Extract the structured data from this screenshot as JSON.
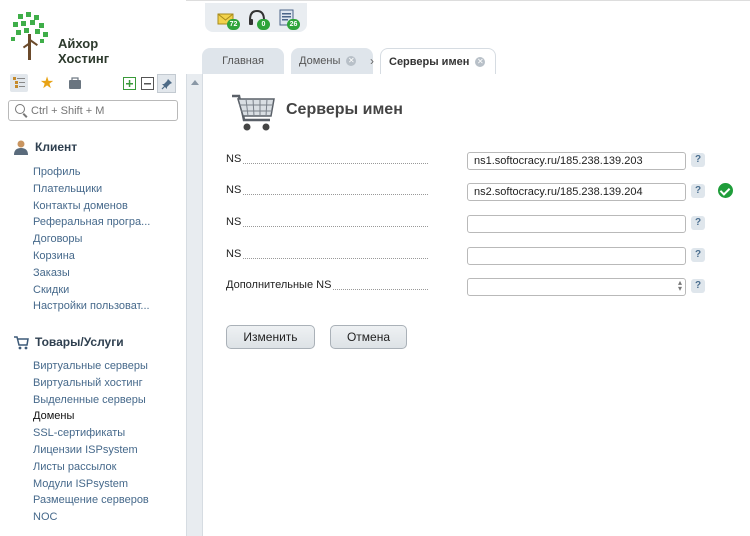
{
  "brand": {
    "line1": "Айхор",
    "line2": "Хостинг"
  },
  "search": {
    "placeholder": "Ctrl + Shift + M"
  },
  "notifications": [
    {
      "icon": "mail-icon",
      "count": "72"
    },
    {
      "icon": "headset-icon",
      "count": "0"
    },
    {
      "icon": "document-icon",
      "count": "26"
    }
  ],
  "tabs": [
    {
      "label": "Главная"
    },
    {
      "label": "Домены"
    },
    {
      "label": "Серверы имен"
    }
  ],
  "client": {
    "title": "Клиент",
    "items": [
      "Профиль",
      "Плательщики",
      "Контакты доменов",
      "Реферальная програ...",
      "Договоры",
      "Корзина",
      "Заказы",
      "Скидки",
      "Настройки пользоват..."
    ]
  },
  "goods": {
    "title": "Товары/Услуги",
    "items": [
      "Виртуальные серверы",
      "Виртуальный хостинг",
      "Выделенные серверы",
      "Домены",
      "SSL-сертификаты",
      "Лицензии ISPsystem",
      "Листы рассылок",
      "Модули ISPsystem",
      "Размещение серверов",
      "NOC"
    ],
    "active": "Домены"
  },
  "form": {
    "title": "Серверы имен",
    "rows": [
      {
        "label": "NS",
        "value": "ns1.softocracy.ru/185.238.139.203"
      },
      {
        "label": "NS",
        "value": "ns2.softocracy.ru/185.238.139.204"
      },
      {
        "label": "NS",
        "value": ""
      },
      {
        "label": "NS",
        "value": ""
      },
      {
        "label": "Дополнительные NS",
        "value": ""
      }
    ],
    "help": "?",
    "submit": "Изменить",
    "cancel": "Отмена"
  },
  "colors": {
    "link": "#46698b",
    "badge": "#2ea43a",
    "ok": "#1f9d3a"
  }
}
